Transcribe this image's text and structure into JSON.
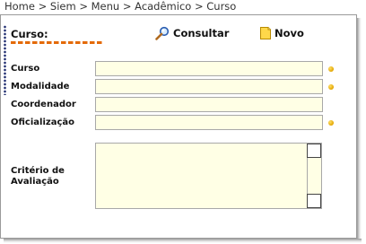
{
  "breadcrumb": "Home > Siem > Menu > Acadêmico > Curso",
  "section": {
    "title": "Curso:"
  },
  "toolbar": {
    "consultar_label": "Consultar",
    "novo_label": "Novo"
  },
  "form": {
    "curso_label": "Curso",
    "modalidade_label": "Modalidade",
    "coordenador_label": "Coordenador",
    "oficializacao_label": "Oficialização",
    "criterio_label_line1": "Critério de",
    "criterio_label_line2": "Avaliação"
  },
  "colors": {
    "field_background": "#ffffe5",
    "accent_orange": "#e46a08",
    "required_dot": "#e2a400",
    "dotline_navy": "#1c2a6e"
  },
  "icons": {
    "consultar": "magnifier-icon",
    "novo": "new-document-icon",
    "required": "required-dot-icon"
  }
}
